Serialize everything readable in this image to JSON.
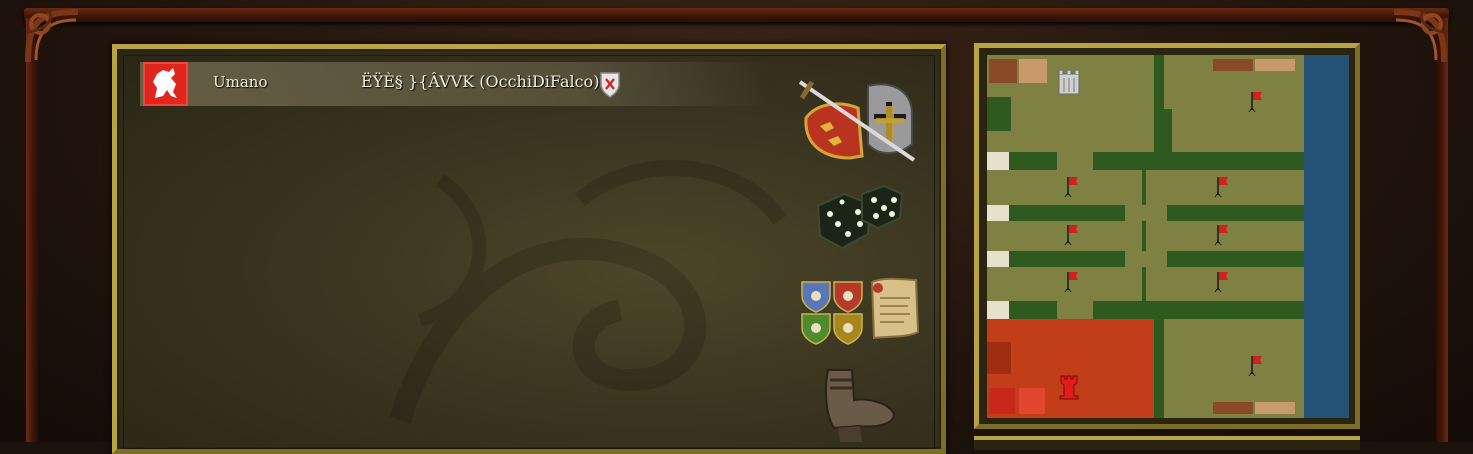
{
  "players": [
    {
      "crest_color": "#e0271d",
      "race": "Umano",
      "name": "ËŸÈ§ }{ÂVVK (OcchiDiFalco)"
    }
  ],
  "side_icons": [
    "knight-helmet-sword-icon",
    "dice-icon",
    "team-shields-icon",
    "scroll-icon",
    "boot-icon"
  ],
  "minimap": {
    "colors": {
      "grass": "#7f8143",
      "dark_grass": "#2f5a1f",
      "water": "#235276",
      "player_zone": "#c23e18"
    },
    "markers": [
      "castle-icon",
      "red-flag-icon",
      "red-tower-icon"
    ]
  }
}
